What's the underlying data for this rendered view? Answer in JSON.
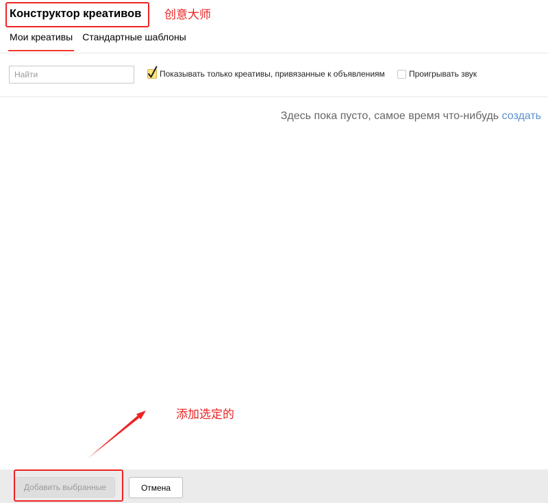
{
  "header": {
    "title": "Конструктор креативов"
  },
  "tabs": [
    {
      "label": "Мои креативы",
      "active": true
    },
    {
      "label": "Стандартные шаблоны",
      "active": false
    }
  ],
  "filters": {
    "search": {
      "placeholder": "Найти"
    },
    "linked_only": {
      "label": "Показывать только креативы, привязанные к объявлениям",
      "checked": true,
      "icon": "check-icon"
    },
    "play_sound": {
      "label": "Проигрывать звук",
      "checked": false
    }
  },
  "empty_state": {
    "message": "Здесь пока пусто, самое время что-нибудь",
    "link": "создать"
  },
  "footer": {
    "add_selected": {
      "label": "Добавить выбранные",
      "disabled": true
    },
    "cancel": {
      "label": "Отмена"
    }
  },
  "annotations": {
    "title_note": "创意大师",
    "add_button_note": "添加选定的"
  },
  "colors": {
    "annotation": "#ee2222",
    "active_tab": "#f5332c",
    "link": "#5b8fd2",
    "checkbox_checked": "#ffe27c"
  }
}
